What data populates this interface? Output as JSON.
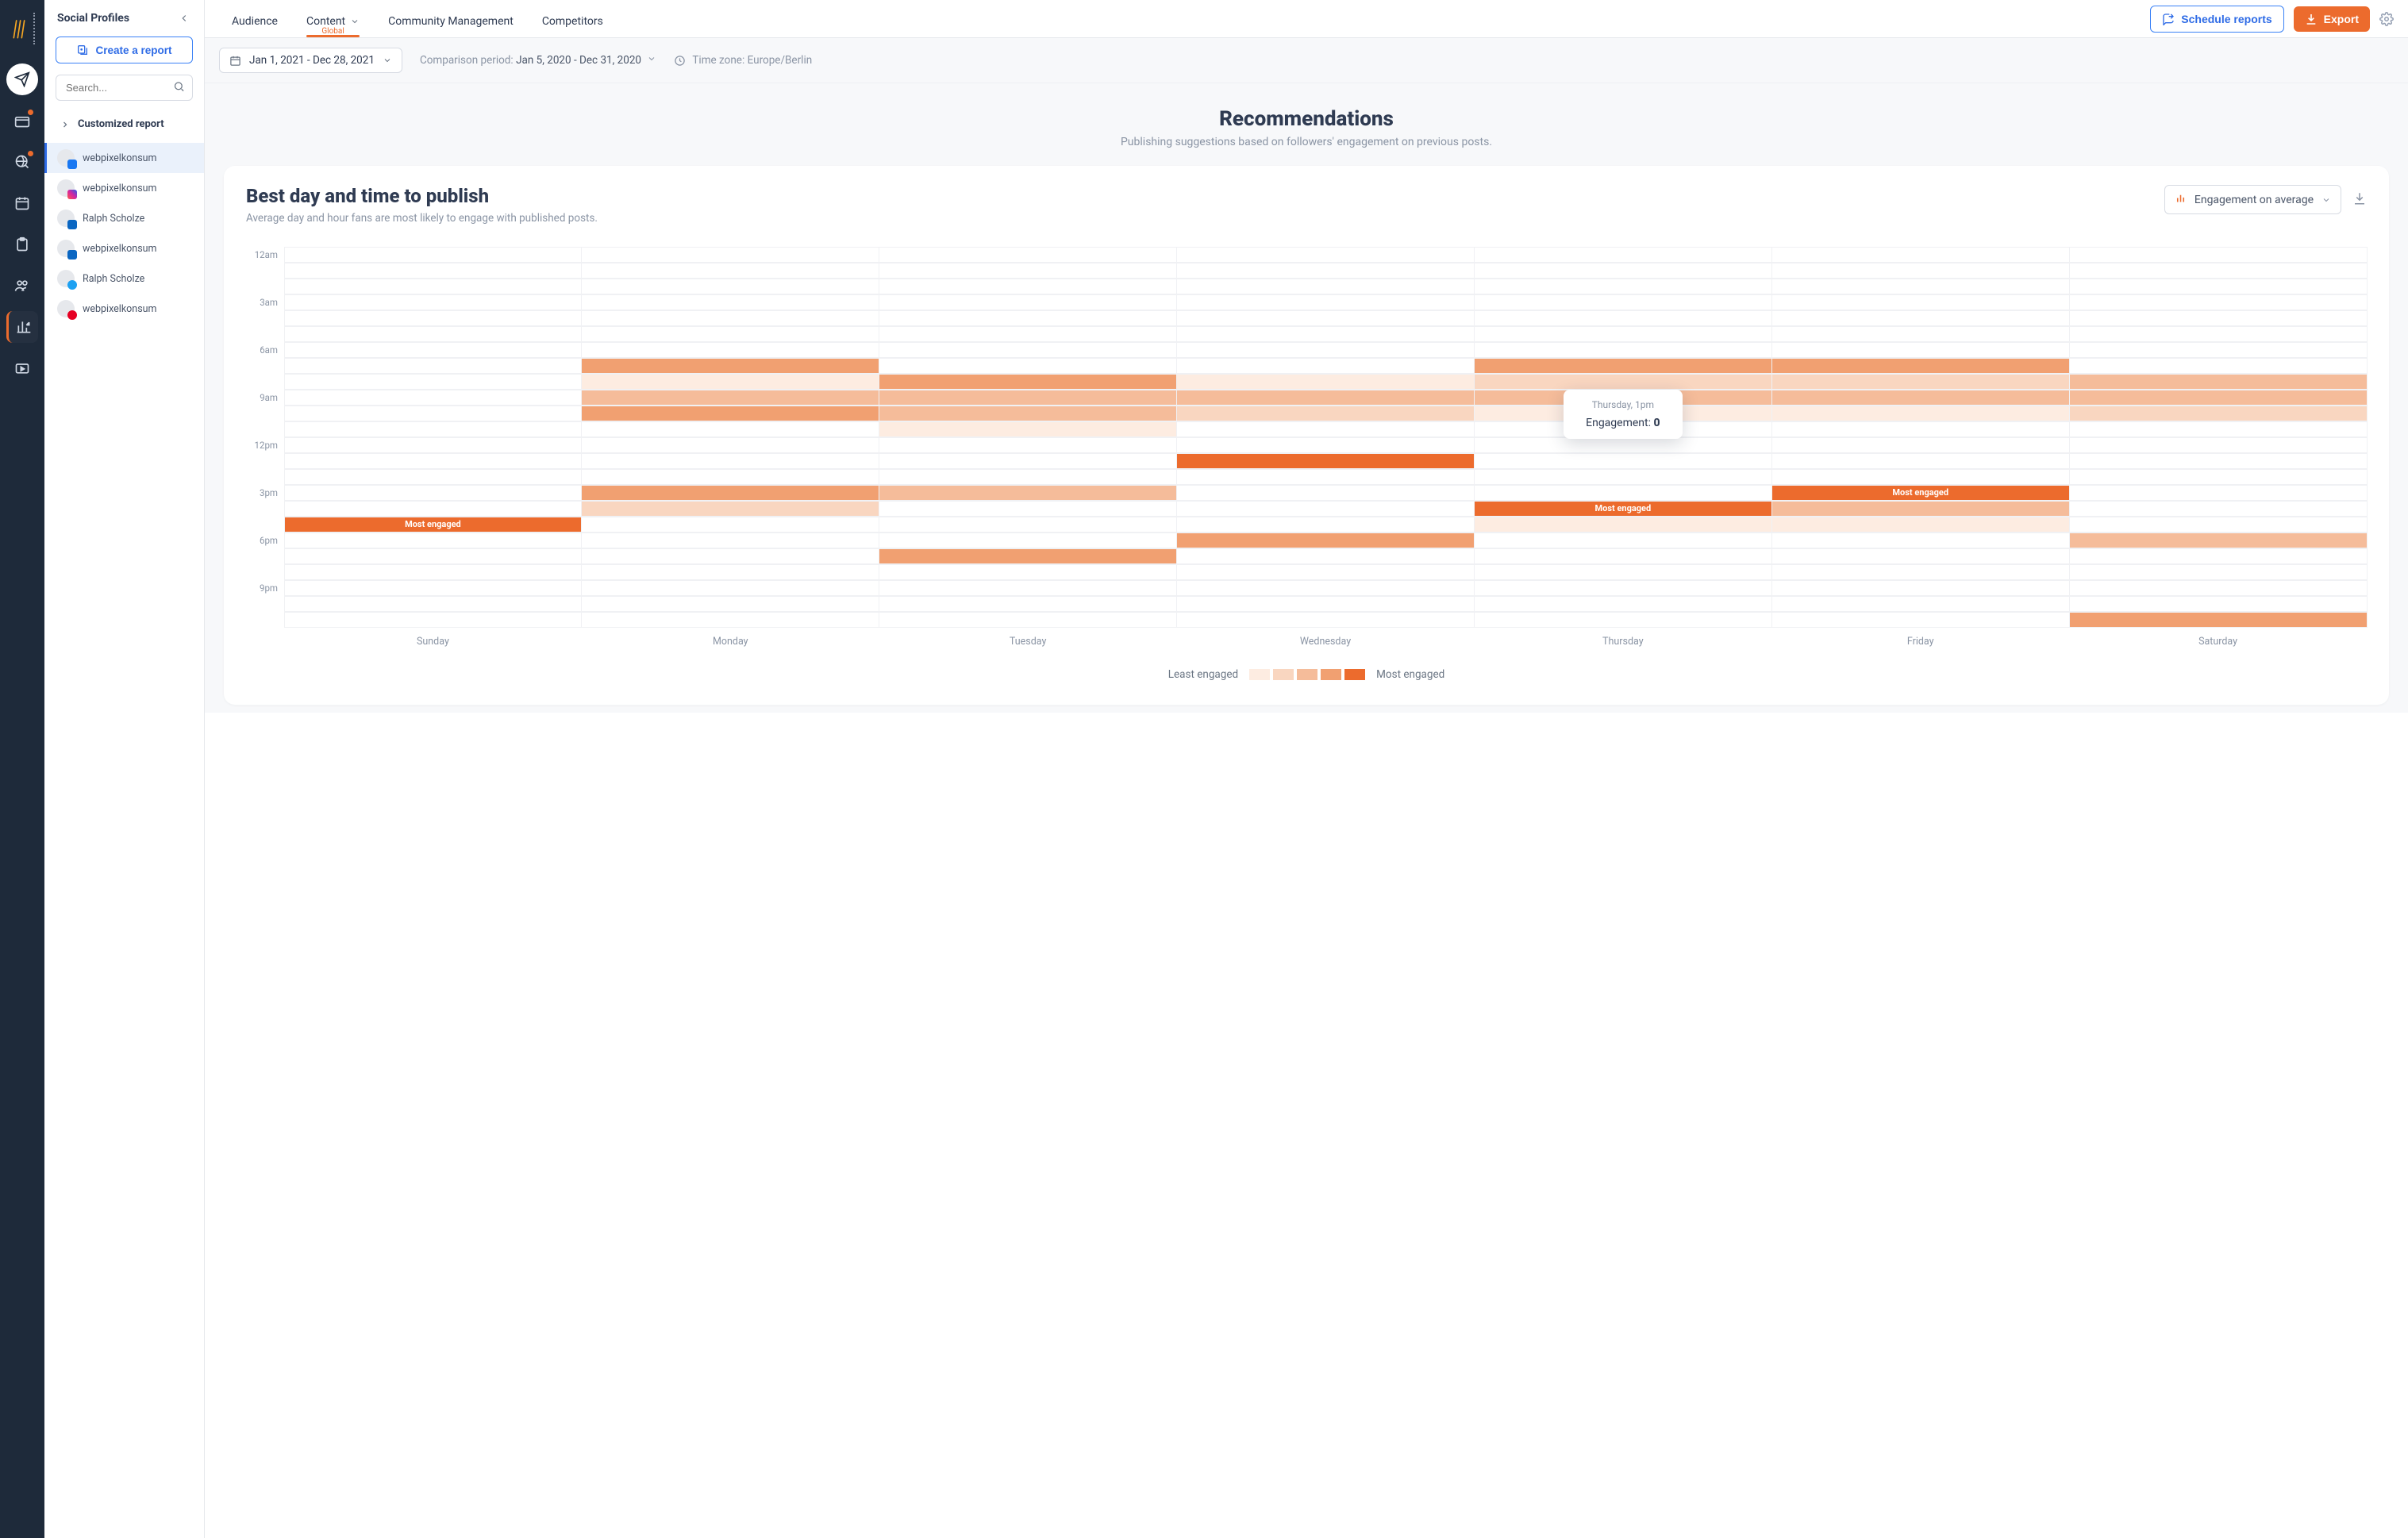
{
  "vnav": {
    "items": [
      "paperplane",
      "dashboard",
      "globe",
      "calendar",
      "clipboard",
      "people",
      "analytics",
      "video"
    ]
  },
  "sidebar": {
    "title": "Social Profiles",
    "create_label": "Create a report",
    "search_placeholder": "Search...",
    "subhead": "Customized report",
    "profiles": [
      {
        "name": "webpixelkonsum",
        "net": "fb",
        "selected": true
      },
      {
        "name": "webpixelkonsum",
        "net": "ig",
        "selected": false
      },
      {
        "name": "Ralph Scholze",
        "net": "in",
        "selected": false
      },
      {
        "name": "webpixelkonsum",
        "net": "in",
        "selected": false
      },
      {
        "name": "Ralph Scholze",
        "net": "tw",
        "selected": false
      },
      {
        "name": "webpixelkonsum",
        "net": "pin",
        "selected": false
      }
    ]
  },
  "topbar": {
    "tabs": [
      "Audience",
      "Content",
      "Community Management",
      "Competitors"
    ],
    "active_tab_index": 1,
    "active_tab_sub": "Global",
    "schedule_label": "Schedule reports",
    "export_label": "Export"
  },
  "filters": {
    "date_range": "Jan 1, 2021 - Dec 28, 2021",
    "compare_label": "Comparison period:",
    "compare_value": "Jan 5, 2020 - Dec 31, 2020",
    "tz_label": "Time zone: Europe/Berlin"
  },
  "reco": {
    "title": "Recommendations",
    "sub": "Publishing suggestions based on followers' engagement on previous posts."
  },
  "card": {
    "title": "Best day and time to publish",
    "sub": "Average day and hour fans are most likely to engage with published posts.",
    "select_label": "Engagement on average"
  },
  "tooltip": {
    "time": "Thursday, 1pm",
    "label": "Engagement:",
    "value": "0",
    "day_index": 4,
    "hour_index": 13
  },
  "legend": {
    "least": "Least engaged",
    "most": "Most engaged"
  },
  "most_engaged_label": "Most engaged",
  "colors": {
    "levels": [
      "#ffffff",
      "#fdece1",
      "#f9d6c0",
      "#f5bc9a",
      "#f1a071",
      "#ec6b2d"
    ]
  },
  "chart_data": {
    "type": "heatmap",
    "title": "Best day and time to publish",
    "xlabel": "Day of week",
    "ylabel": "Hour of day",
    "days": [
      "Sunday",
      "Monday",
      "Tuesday",
      "Wednesday",
      "Thursday",
      "Friday",
      "Saturday"
    ],
    "hours": [
      "12am",
      "1am",
      "2am",
      "3am",
      "4am",
      "5am",
      "6am",
      "7am",
      "8am",
      "9am",
      "10am",
      "11am",
      "12pm",
      "1pm",
      "2pm",
      "3pm",
      "4pm",
      "5pm",
      "6pm",
      "7pm",
      "8pm",
      "9pm",
      "10pm",
      "11pm"
    ],
    "y_tick_labels": [
      "12am",
      "3am",
      "6am",
      "9am",
      "12pm",
      "3pm",
      "6pm",
      "9pm"
    ],
    "intensity": [
      [
        0,
        0,
        0,
        0,
        0,
        0,
        0
      ],
      [
        0,
        0,
        0,
        0,
        0,
        0,
        0
      ],
      [
        0,
        0,
        0,
        0,
        0,
        0,
        0
      ],
      [
        0,
        0,
        0,
        0,
        0,
        0,
        0
      ],
      [
        0,
        0,
        0,
        0,
        0,
        0,
        0
      ],
      [
        0,
        0,
        0,
        0,
        0,
        0,
        0
      ],
      [
        0,
        0,
        0,
        0,
        0,
        0,
        0
      ],
      [
        0,
        4,
        0,
        0,
        4,
        4,
        0
      ],
      [
        0,
        1,
        4,
        1,
        2,
        2,
        3
      ],
      [
        0,
        3,
        3,
        3,
        3,
        3,
        3
      ],
      [
        0,
        4,
        3,
        2,
        1,
        1,
        2
      ],
      [
        0,
        0,
        1,
        0,
        0,
        0,
        0
      ],
      [
        0,
        0,
        0,
        0,
        0,
        0,
        0
      ],
      [
        0,
        0,
        0,
        5,
        0,
        0,
        0
      ],
      [
        0,
        0,
        0,
        0,
        0,
        0,
        0
      ],
      [
        0,
        4,
        3,
        0,
        0,
        5,
        0
      ],
      [
        0,
        2,
        0,
        0,
        5,
        3,
        0
      ],
      [
        5,
        0,
        0,
        0,
        1,
        1,
        0
      ],
      [
        0,
        0,
        0,
        4,
        0,
        0,
        3
      ],
      [
        0,
        0,
        4,
        0,
        0,
        0,
        0
      ],
      [
        0,
        0,
        0,
        0,
        0,
        0,
        0
      ],
      [
        0,
        0,
        0,
        0,
        0,
        0,
        0
      ],
      [
        0,
        0,
        0,
        0,
        0,
        0,
        0
      ],
      [
        0,
        0,
        0,
        0,
        0,
        0,
        4
      ]
    ],
    "most_engaged_cells": [
      {
        "day": 0,
        "hour": 17
      },
      {
        "day": 4,
        "hour": 16
      },
      {
        "day": 5,
        "hour": 15
      }
    ],
    "legend_levels": 5
  }
}
